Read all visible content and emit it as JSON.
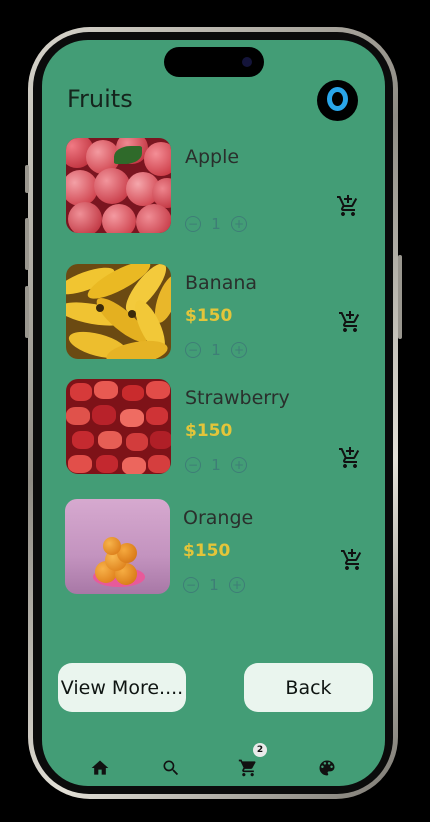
{
  "app": {
    "title": "Fruits"
  },
  "products": [
    {
      "name": "Apple",
      "price": "",
      "quantity": "1",
      "image_icon": "apple-photo"
    },
    {
      "name": "Banana",
      "price": "$150",
      "quantity": "1",
      "image_icon": "banana-photo"
    },
    {
      "name": "Strawberry",
      "price": "$150",
      "quantity": "1",
      "image_icon": "strawberry-photo"
    },
    {
      "name": "Orange",
      "price": "$150",
      "quantity": "1",
      "image_icon": "orange-photo"
    }
  ],
  "stepper": {
    "minus_symbol": "−",
    "plus_symbol": "+"
  },
  "actions": {
    "view_more_label": "View More....",
    "back_label": "Back"
  },
  "nav": {
    "items": [
      "home-icon",
      "search-icon",
      "cart-icon",
      "palette-icon"
    ],
    "cart_badge": "2"
  },
  "colors": {
    "screen_background": "#439d76",
    "price": "#e3c53a",
    "stepper": "#3e7e77",
    "button_background": "#eaf5ee"
  }
}
